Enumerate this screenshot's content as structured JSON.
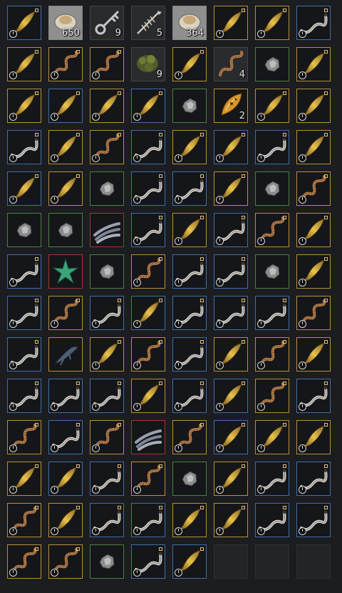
{
  "inventory": {
    "columns": 8,
    "slots": [
      {
        "item": "fish",
        "quality": "blue",
        "clock": true
      },
      {
        "item": "pearl",
        "quality": "white",
        "count": "650"
      },
      {
        "item": "key",
        "quality": "gray",
        "count": "9"
      },
      {
        "item": "bones",
        "quality": "gray",
        "count": "5"
      },
      {
        "item": "pearl",
        "quality": "white",
        "count": "364"
      },
      {
        "item": "fish",
        "quality": "gold",
        "clock": true
      },
      {
        "item": "fish",
        "quality": "gold",
        "clock": true
      },
      {
        "item": "eel",
        "quality": "blue",
        "clock": true
      },
      {
        "item": "fish",
        "quality": "gold",
        "clock": true
      },
      {
        "item": "worm",
        "quality": "gold",
        "clock": true
      },
      {
        "item": "worm",
        "quality": "gold",
        "clock": true
      },
      {
        "item": "herb",
        "quality": "gray",
        "count": "9"
      },
      {
        "item": "fish",
        "quality": "gold",
        "clock": true
      },
      {
        "item": "worm",
        "quality": "gray",
        "count": "4"
      },
      {
        "item": "ore",
        "quality": "green"
      },
      {
        "item": "fish",
        "quality": "gold",
        "clock": true
      },
      {
        "item": "fish",
        "quality": "gold",
        "clock": true
      },
      {
        "item": "fish",
        "quality": "blue",
        "clock": true
      },
      {
        "item": "fish",
        "quality": "gold",
        "clock": true
      },
      {
        "item": "fish",
        "quality": "blue",
        "clock": true
      },
      {
        "item": "ore",
        "quality": "green"
      },
      {
        "item": "butterfly",
        "quality": "gold",
        "count": "2"
      },
      {
        "item": "fish",
        "quality": "gold",
        "clock": true
      },
      {
        "item": "fish",
        "quality": "gold",
        "clock": true
      },
      {
        "item": "eel",
        "quality": "blue",
        "clock": true
      },
      {
        "item": "fish",
        "quality": "gold",
        "clock": true
      },
      {
        "item": "worm",
        "quality": "gold",
        "clock": true
      },
      {
        "item": "eel",
        "quality": "blue",
        "clock": true
      },
      {
        "item": "fish",
        "quality": "gold",
        "clock": true
      },
      {
        "item": "fish",
        "quality": "blue",
        "clock": true
      },
      {
        "item": "eel",
        "quality": "blue",
        "clock": true
      },
      {
        "item": "fish",
        "quality": "gold",
        "clock": true
      },
      {
        "item": "fish",
        "quality": "blue",
        "clock": true
      },
      {
        "item": "fish",
        "quality": "gold",
        "clock": true
      },
      {
        "item": "ore",
        "quality": "green"
      },
      {
        "item": "eel",
        "quality": "blue",
        "clock": true
      },
      {
        "item": "eel",
        "quality": "blue",
        "clock": true
      },
      {
        "item": "fish",
        "quality": "gold",
        "clock": true
      },
      {
        "item": "ore",
        "quality": "green"
      },
      {
        "item": "worm",
        "quality": "gold",
        "clock": true
      },
      {
        "item": "ore",
        "quality": "green"
      },
      {
        "item": "ore",
        "quality": "green"
      },
      {
        "item": "fishbundle",
        "quality": "red"
      },
      {
        "item": "eel",
        "quality": "blue",
        "clock": true
      },
      {
        "item": "fish",
        "quality": "gold",
        "clock": true
      },
      {
        "item": "eel",
        "quality": "blue",
        "clock": true
      },
      {
        "item": "worm",
        "quality": "gold",
        "clock": true
      },
      {
        "item": "fish",
        "quality": "gold",
        "clock": true
      },
      {
        "item": "eel",
        "quality": "blue",
        "clock": true
      },
      {
        "item": "starfish",
        "quality": "red"
      },
      {
        "item": "ore",
        "quality": "green"
      },
      {
        "item": "worm",
        "quality": "gold",
        "clock": true
      },
      {
        "item": "eel",
        "quality": "blue",
        "clock": true
      },
      {
        "item": "eel",
        "quality": "blue",
        "clock": true
      },
      {
        "item": "ore",
        "quality": "green"
      },
      {
        "item": "fish",
        "quality": "gold",
        "clock": true
      },
      {
        "item": "eel",
        "quality": "blue",
        "clock": true
      },
      {
        "item": "worm",
        "quality": "gold",
        "clock": true
      },
      {
        "item": "eel",
        "quality": "blue",
        "clock": true
      },
      {
        "item": "fish",
        "quality": "blue",
        "clock": true
      },
      {
        "item": "eel",
        "quality": "blue",
        "clock": true
      },
      {
        "item": "eel",
        "quality": "blue",
        "clock": true
      },
      {
        "item": "eel",
        "quality": "blue",
        "clock": true
      },
      {
        "item": "worm",
        "quality": "gold",
        "clock": true
      },
      {
        "item": "eel",
        "quality": "blue",
        "clock": true
      },
      {
        "item": "lizardfish",
        "quality": "gold"
      },
      {
        "item": "fish",
        "quality": "gold",
        "clock": true
      },
      {
        "item": "worm",
        "quality": "gold",
        "clock": true
      },
      {
        "item": "eel",
        "quality": "blue",
        "clock": true
      },
      {
        "item": "fish",
        "quality": "gold",
        "clock": true
      },
      {
        "item": "worm",
        "quality": "gold",
        "clock": true
      },
      {
        "item": "fish",
        "quality": "gold",
        "clock": true
      },
      {
        "item": "eel",
        "quality": "blue",
        "clock": true
      },
      {
        "item": "eel",
        "quality": "blue",
        "clock": true
      },
      {
        "item": "eel",
        "quality": "blue",
        "clock": true
      },
      {
        "item": "fish",
        "quality": "gold",
        "clock": true
      },
      {
        "item": "eel",
        "quality": "blue",
        "clock": true
      },
      {
        "item": "fish",
        "quality": "blue",
        "clock": true
      },
      {
        "item": "worm",
        "quality": "gold",
        "clock": true
      },
      {
        "item": "eel",
        "quality": "blue",
        "clock": true
      },
      {
        "item": "worm",
        "quality": "gold",
        "clock": true
      },
      {
        "item": "eel",
        "quality": "blue",
        "clock": true
      },
      {
        "item": "worm",
        "quality": "gold",
        "clock": true
      },
      {
        "item": "fishbundle",
        "quality": "red"
      },
      {
        "item": "worm",
        "quality": "gold",
        "clock": true
      },
      {
        "item": "fish",
        "quality": "blue",
        "clock": true
      },
      {
        "item": "fish",
        "quality": "gold",
        "clock": true
      },
      {
        "item": "fish",
        "quality": "gold",
        "clock": true
      },
      {
        "item": "fish",
        "quality": "gold",
        "clock": true
      },
      {
        "item": "fish",
        "quality": "blue",
        "clock": true
      },
      {
        "item": "eel",
        "quality": "blue",
        "clock": true
      },
      {
        "item": "worm",
        "quality": "gold",
        "clock": true
      },
      {
        "item": "ore",
        "quality": "green"
      },
      {
        "item": "fish",
        "quality": "gold",
        "clock": true
      },
      {
        "item": "eel",
        "quality": "blue",
        "clock": true
      },
      {
        "item": "eel",
        "quality": "blue",
        "clock": true
      },
      {
        "item": "worm",
        "quality": "gold",
        "clock": true
      },
      {
        "item": "fish",
        "quality": "gold",
        "clock": true
      },
      {
        "item": "eel",
        "quality": "blue",
        "clock": true
      },
      {
        "item": "eel",
        "quality": "blue",
        "clock": true
      },
      {
        "item": "fish",
        "quality": "gold",
        "clock": true
      },
      {
        "item": "fish",
        "quality": "gold",
        "clock": true
      },
      {
        "item": "eel",
        "quality": "blue",
        "clock": true
      },
      {
        "item": "eel",
        "quality": "blue",
        "clock": true
      },
      {
        "item": "worm",
        "quality": "gold",
        "clock": true
      },
      {
        "item": "worm",
        "quality": "gold",
        "clock": true
      },
      {
        "item": "ore",
        "quality": "green"
      },
      {
        "item": "eel",
        "quality": "blue",
        "clock": true
      },
      {
        "item": "fish",
        "quality": "blue",
        "clock": true
      },
      {
        "item": "empty"
      },
      {
        "item": "empty"
      },
      {
        "item": "empty"
      }
    ]
  }
}
